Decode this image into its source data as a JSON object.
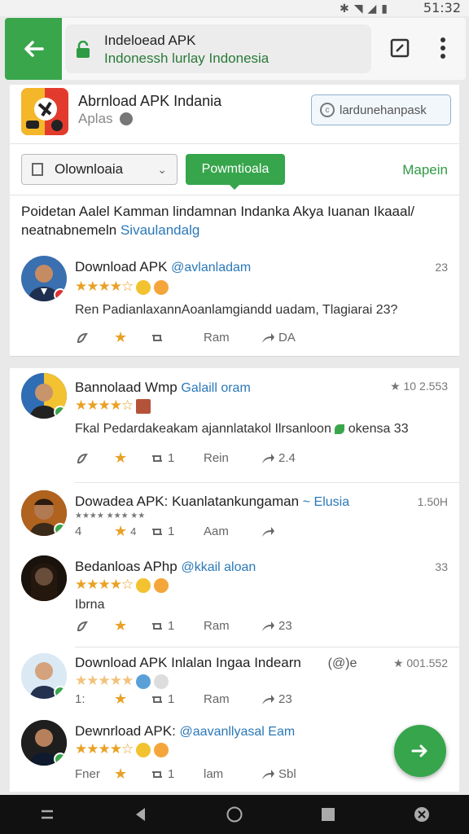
{
  "status": {
    "time": "51:32"
  },
  "urlbar": {
    "title": "Indeloead APK",
    "subtitle": "Indonessh lurlay Indonesia"
  },
  "app": {
    "title": "Abrnload APK Indania",
    "subtitle": "Aplas",
    "action_label": "lardunehanpask",
    "filter_select_value": "Olownloaia",
    "primary_button": "Powmtioala",
    "right_link": "Mapein",
    "description_main": "Poidetan Aalel Kamman lindamnan Indanka Akya Iuanan Ikaaal/ neatnabnemeln",
    "description_tag": "Sivaulandalg"
  },
  "colors": {
    "accent": "#36a54b",
    "link": "#2b78b8",
    "star": "#e9a124"
  },
  "posts": [
    {
      "name": "Download APK",
      "handle": "@avlanladam",
      "meta": "23",
      "stars": "★★★★☆",
      "text": "Ren PadianlaxannAoanlamgiandd uadam, Tlagiarai 23?",
      "reply": "",
      "retweet": "",
      "like": "Ram",
      "share": "DA"
    },
    {
      "name": "Bannolaad Wmp",
      "handle": "Galaill oram",
      "meta": "★ 10 2.553",
      "stars": "★★★★☆",
      "text": "Fkal Pedardakeakam ajannlatakol Ilrsanloon",
      "text_tag": "okensa 33",
      "reply": "",
      "retweet": "1",
      "like": "Rein",
      "share": "2.4"
    },
    {
      "name": "Dowadea APK: Kuanlatankungaman",
      "handle": "~ Elusia",
      "meta": "1.50H",
      "stars": "4",
      "text": "",
      "reply": "4",
      "retweet": "1",
      "like": "Aam",
      "share": ""
    },
    {
      "name": "Bedanloas APhp",
      "handle": "@kkail aloan",
      "meta": "33",
      "stars": "★★★★☆",
      "text": "Ibrna",
      "reply": "",
      "retweet": "1",
      "like": "Ram",
      "share": "23"
    },
    {
      "name": "Download APK Inlalan Ingaa Indearn",
      "handle": "(@)e",
      "meta": "★ 001.552",
      "stars": "★★★★★",
      "text": "",
      "reply": "1:",
      "retweet": "1",
      "like": "Ram",
      "share": "23"
    },
    {
      "name": "Dewnrload APK:",
      "handle": "@aavanllyasal Eam",
      "meta": "",
      "stars": "★★★★☆",
      "text": "",
      "reply": "Fner",
      "retweet": "1",
      "like": "lam",
      "share": "Sbl"
    }
  ]
}
